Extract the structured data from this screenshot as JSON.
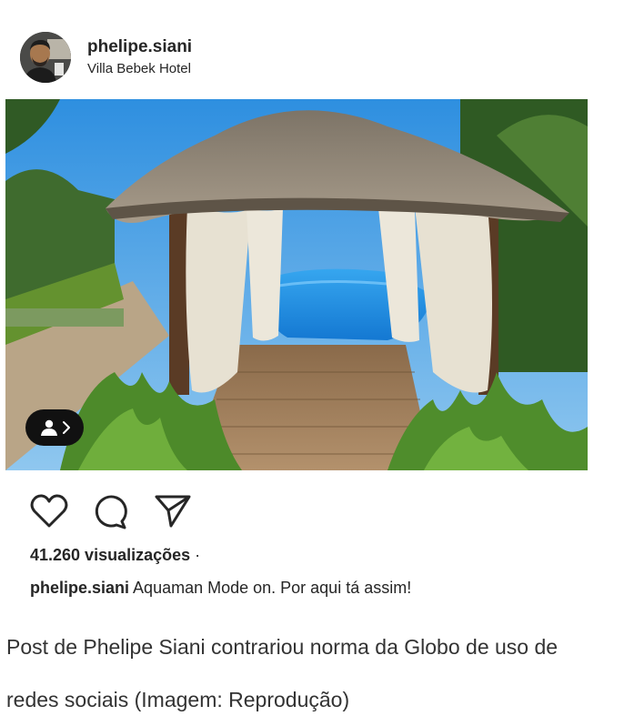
{
  "post": {
    "username": "phelipe.siani",
    "location": "Villa Bebek Hotel",
    "views_count": "41.260 visualizações",
    "views_separator": " ·",
    "caption_username": "phelipe.siani",
    "caption_text": "Aquaman Mode on. Por aqui tá assim!"
  },
  "icons": {
    "like": "heart-icon",
    "comment": "comment-icon",
    "share": "send-icon",
    "tagged": "user-tag-icon"
  },
  "figure_caption": "Post de Phelipe Siani contrariou norma da Globo de uso de redes sociais (Imagem: Reprodução)"
}
